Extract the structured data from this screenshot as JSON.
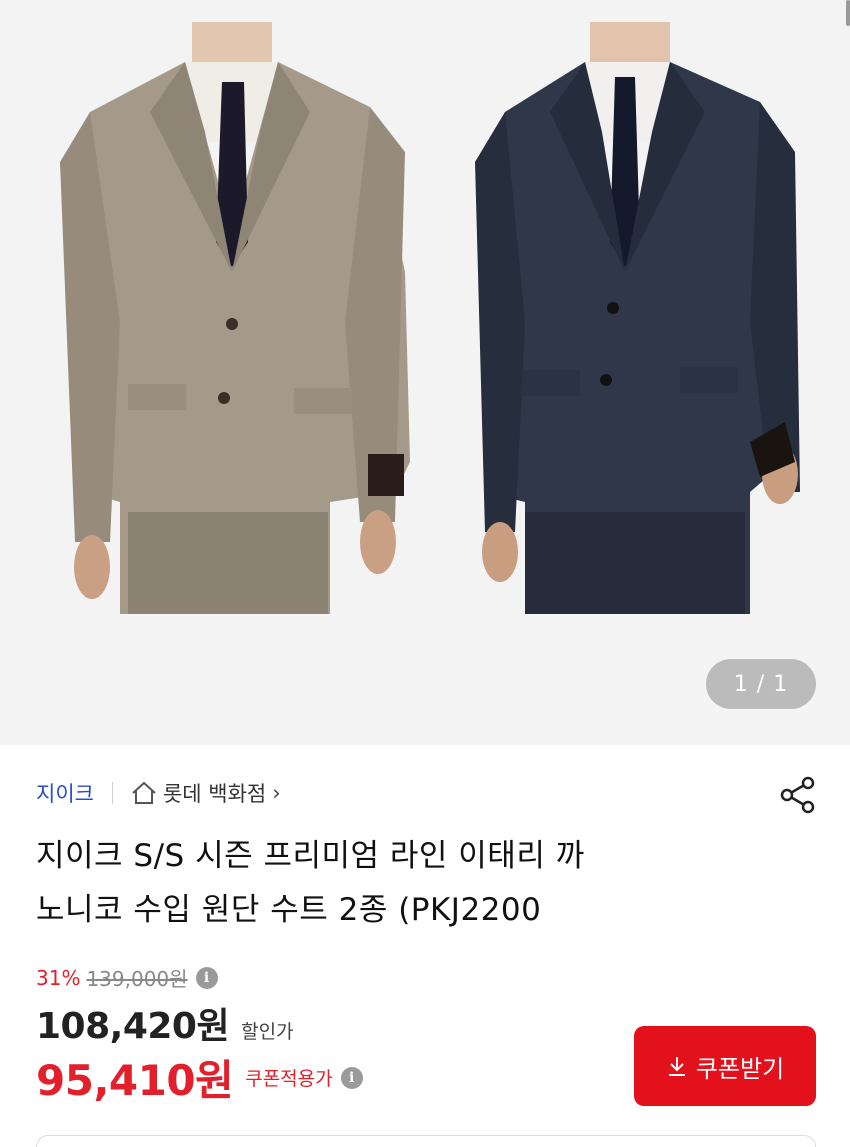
{
  "gallery": {
    "page_indicator": "1 / 1",
    "images": [
      {
        "name": "beige-suit-photo",
        "suit_color": "#9e9383"
      },
      {
        "name": "navy-suit-photo",
        "suit_color": "#2c3445"
      }
    ]
  },
  "product": {
    "brand": "지이크",
    "store": "롯데 백화점",
    "store_chevron": "›",
    "title_line1": "지이크 S/S 시즌 프리미엄 라인 이태리 까",
    "title_line2": "노니코 수입 원단 수트 2종 (PKJ2200",
    "discount_rate": "31%",
    "original_price": "139,000원",
    "sale_price": "108,420원",
    "sale_label": "할인가",
    "coupon_price": "95,410원",
    "coupon_label": "쿠폰적용가",
    "coupon_button": "쿠폰받기"
  },
  "icons": {
    "home": "home-icon",
    "share": "share-icon",
    "info": "info-icon",
    "download": "download-icon"
  },
  "colors": {
    "brand_blue": "#2b4cc8",
    "accent_red": "#e2202c",
    "button_red": "#e2111c"
  }
}
